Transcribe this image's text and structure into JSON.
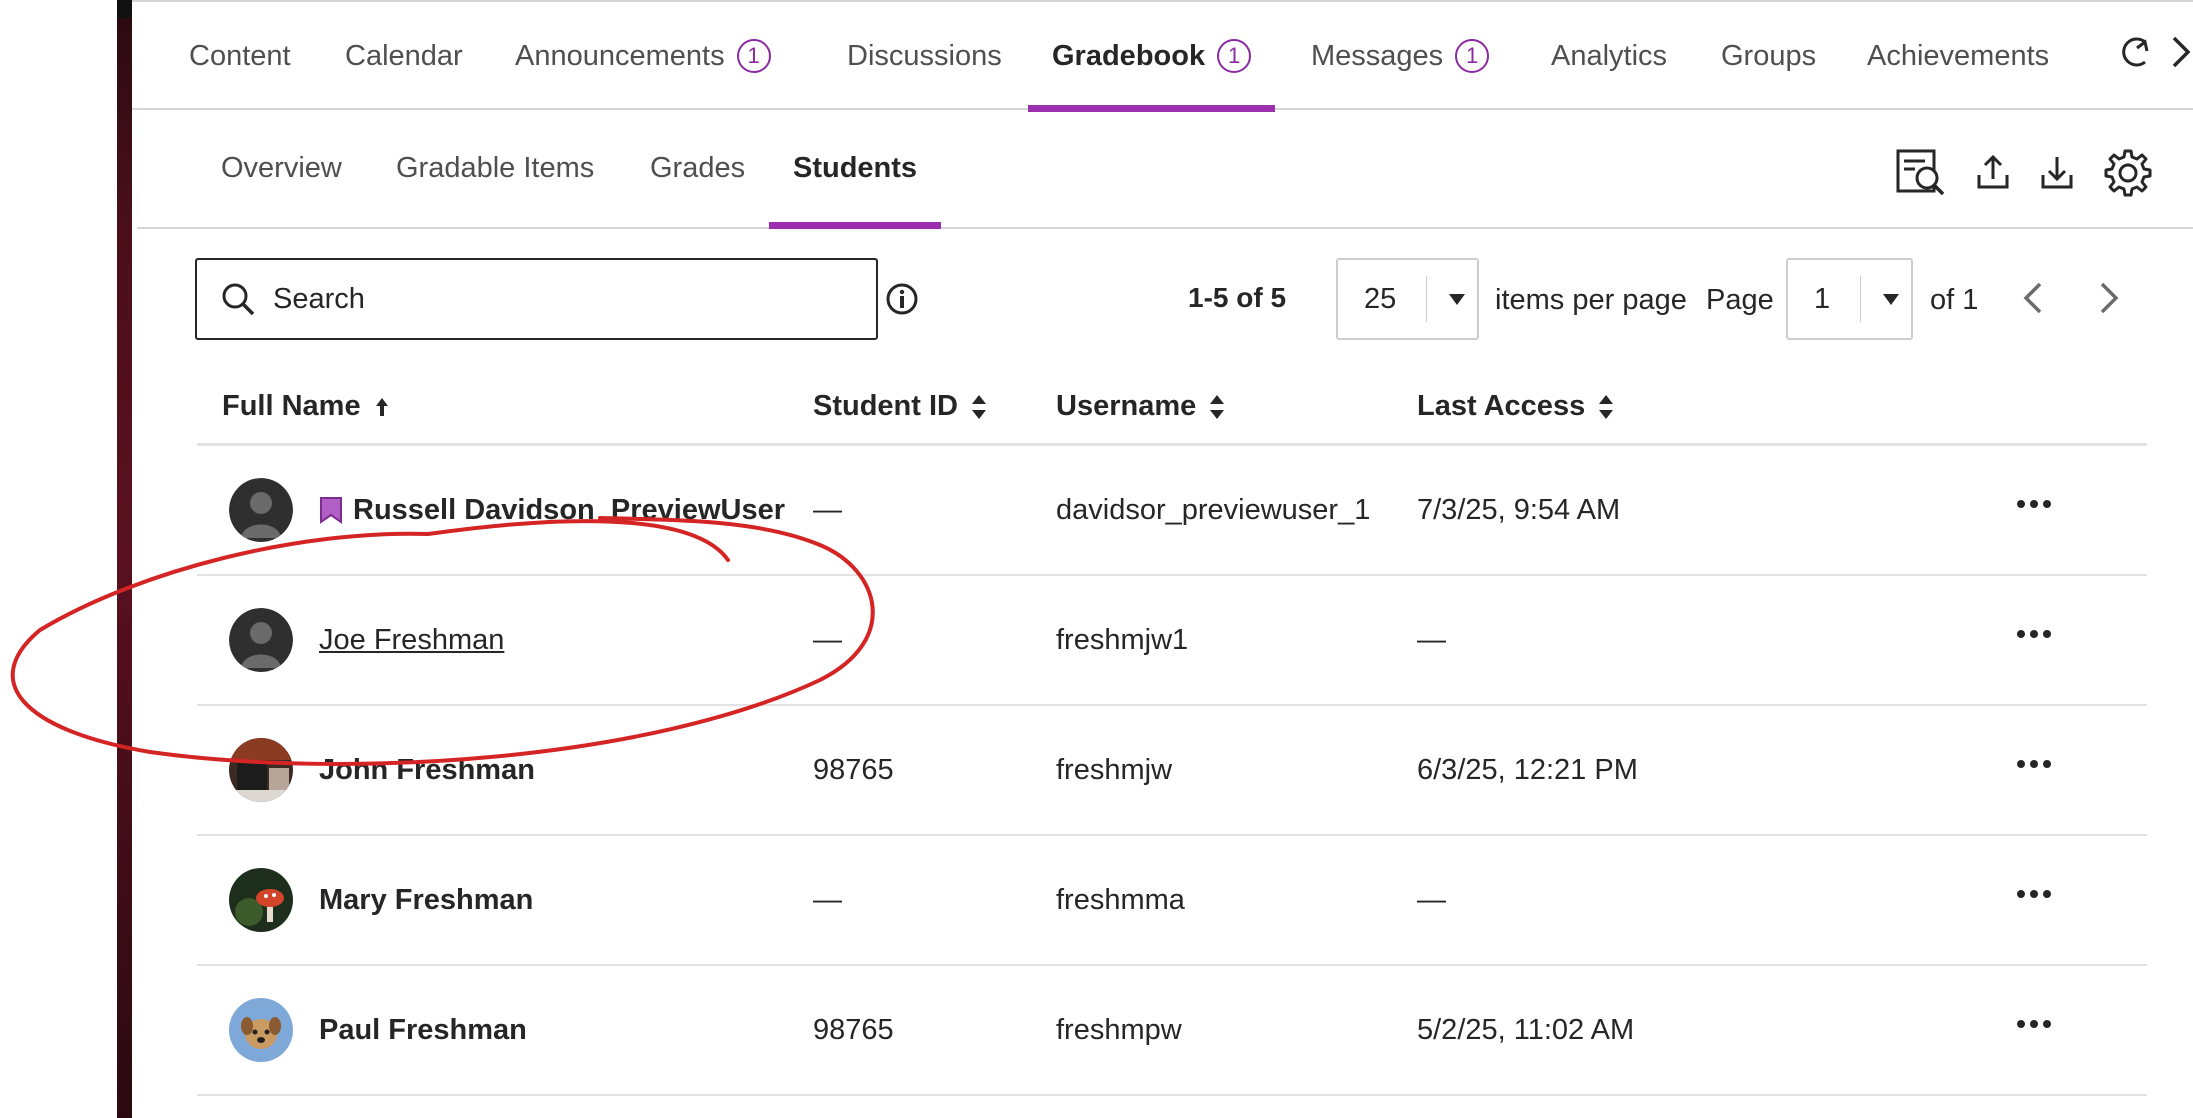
{
  "nav": {
    "tabs": [
      {
        "label": "Content"
      },
      {
        "label": "Calendar"
      },
      {
        "label": "Announcements",
        "badge": "1"
      },
      {
        "label": "Discussions"
      },
      {
        "label": "Gradebook",
        "badge": "1",
        "active": true
      },
      {
        "label": "Messages",
        "badge": "1"
      },
      {
        "label": "Analytics"
      },
      {
        "label": "Groups"
      },
      {
        "label": "Achievements"
      }
    ]
  },
  "subnav": {
    "tabs": [
      {
        "label": "Overview"
      },
      {
        "label": "Gradable Items"
      },
      {
        "label": "Grades"
      },
      {
        "label": "Students",
        "active": true
      }
    ]
  },
  "search": {
    "placeholder": "Search"
  },
  "pagination": {
    "range": "1-5 of 5",
    "per_page": "25",
    "per_page_label": "items per page",
    "page_label": "Page",
    "page": "1",
    "of_label": "of 1"
  },
  "table": {
    "headers": {
      "name": "Full Name",
      "student_id": "Student ID",
      "username": "Username",
      "last_access": "Last Access"
    },
    "rows": [
      {
        "name": "Russell Davidson_PreviewUser",
        "student_id": "—",
        "username": "davidsor_previewuser_1",
        "last_access": "7/3/25, 9:54 AM"
      },
      {
        "name": "Joe Freshman",
        "student_id": "—",
        "username": "freshmjw1",
        "last_access": "—"
      },
      {
        "name": "John Freshman",
        "student_id": "98765",
        "username": "freshmjw",
        "last_access": "6/3/25, 12:21 PM"
      },
      {
        "name": "Mary Freshman",
        "student_id": "—",
        "username": "freshmma",
        "last_access": "—"
      },
      {
        "name": "Paul Freshman",
        "student_id": "98765",
        "username": "freshmpw",
        "last_access": "5/2/25, 11:02 AM"
      }
    ]
  },
  "colors": {
    "accent": "#9b2fae",
    "annotation": "#d42424"
  }
}
